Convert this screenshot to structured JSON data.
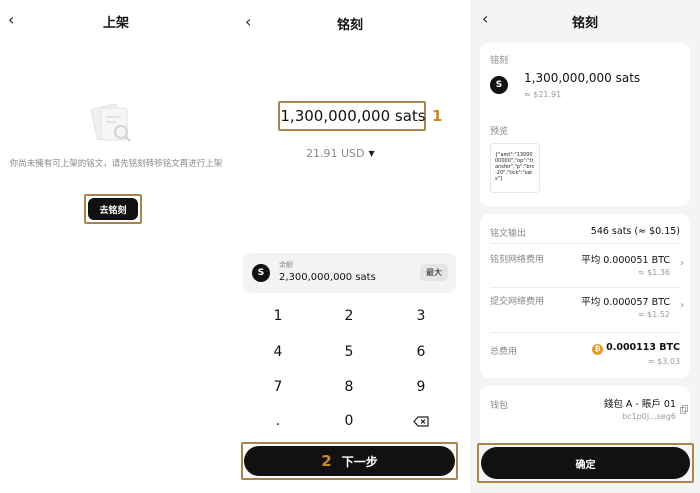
{
  "panel1": {
    "title": "上架",
    "empty_text": "你尚未擁有可上架的铭文，请先铭刻转移铭文再进行上架",
    "inscribe_button": "去铭刻"
  },
  "panel2": {
    "title": "铭刻",
    "amount": "1,300,000,000 sats",
    "step1": "1",
    "usd_value": "21.91 USD",
    "balance_label": "余额",
    "balance_value": "2,300,000,000 sats",
    "max_label": "最大",
    "coin_symbol": "S",
    "keypad": [
      "1",
      "2",
      "3",
      "4",
      "5",
      "6",
      "7",
      "8",
      "9",
      ".",
      "0"
    ],
    "step2": "2",
    "next_label": "下一步"
  },
  "panel3": {
    "title": "铭刻",
    "inscribe_label": "铭刻",
    "amount": "1,300,000,000 sats",
    "amount_usd": "≈ $21.91",
    "coin_symbol": "S",
    "preview_label": "预览",
    "preview_text": "{\"amt\":\"1300000000\",\"op\":\"transfer\",\"p\":\"brc-20\",\"tick\":\"sats\"}",
    "output_label": "铭文输出",
    "output_value": "546 sats (≈ $0.15)",
    "inscribe_fee_label": "铭刻网络费用",
    "inscribe_fee_value": "平均 0.000051 BTC",
    "inscribe_fee_usd": "≈ $1.36",
    "submit_fee_label": "提交网络费用",
    "submit_fee_value": "平均 0.000057 BTC",
    "submit_fee_usd": "≈ $1.52",
    "total_label": "总费用",
    "total_value": "0.000113 BTC",
    "total_usd": "≈ $3.03",
    "btc_symbol": "₿",
    "wallet_label": "钱包",
    "wallet_name": "錢包 A - 賬戶 01",
    "wallet_address": "bc1p0j...seg6",
    "confirm_label": "确定"
  },
  "colors": {
    "highlight": "#a8854f",
    "step_number": "#c9862f",
    "btc": "#e69a2e"
  }
}
